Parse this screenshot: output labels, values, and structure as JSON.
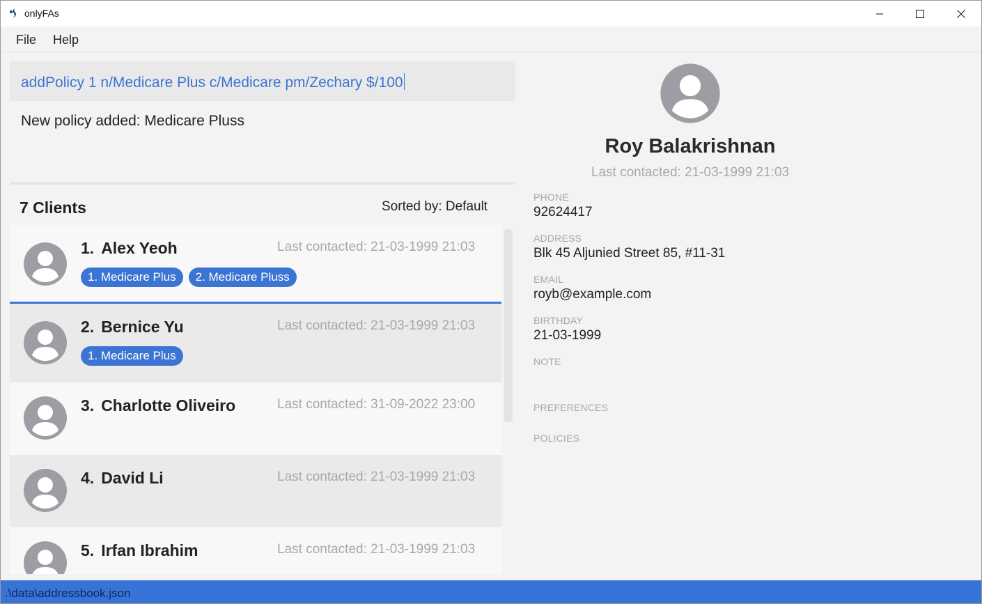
{
  "window": {
    "title": "onlyFAs",
    "icon": "app-logo-icon",
    "controls": [
      "minimize-icon",
      "maximize-icon",
      "close-icon"
    ]
  },
  "menu": {
    "items": [
      {
        "label": "File"
      },
      {
        "label": "Help"
      }
    ]
  },
  "command": {
    "value": "addPolicy 1 n/Medicare Plus c/Medicare pm/Zechary $/100"
  },
  "result": {
    "message": "New policy added: Medicare Pluss"
  },
  "list_header": {
    "count_label": "7 Clients",
    "sorted_label": "Sorted by: Default"
  },
  "clients": [
    {
      "index": "1.",
      "name": "Alex Yeoh",
      "last_contacted": "Last contacted: 21-03-1999 21:03",
      "tags": [
        "1. Medicare Plus",
        "2. Medicare Pluss"
      ]
    },
    {
      "index": "2.",
      "name": "Bernice Yu",
      "last_contacted": "Last contacted: 21-03-1999 21:03",
      "tags": [
        "1. Medicare Plus"
      ]
    },
    {
      "index": "3.",
      "name": "Charlotte Oliveiro",
      "last_contacted": "Last contacted: 31-09-2022 23:00",
      "tags": []
    },
    {
      "index": "4.",
      "name": "David Li",
      "last_contacted": "Last contacted: 21-03-1999 21:03",
      "tags": []
    },
    {
      "index": "5.",
      "name": "Irfan Ibrahim",
      "last_contacted": "Last contacted: 21-03-1999 21:03",
      "tags": []
    }
  ],
  "detail": {
    "name": "Roy Balakrishnan",
    "last_contacted": "Last contacted: 21-03-1999 21:03",
    "phone_label": "PHONE",
    "phone": "92624417",
    "address_label": "ADDRESS",
    "address": "Blk 45 Aljunied Street 85, #11-31",
    "email_label": "EMAIL",
    "email": "royb@example.com",
    "birthday_label": "BIRTHDAY",
    "birthday": "21-03-1999",
    "note_label": "NOTE",
    "preferences_label": "PREFERENCES",
    "policies_label": "POLICIES"
  },
  "status": {
    "path": ".\\data\\addressbook.json"
  },
  "colors": {
    "accent": "#3b74d2",
    "status_bar": "#3873d8",
    "muted_text": "#a8a8ac"
  }
}
